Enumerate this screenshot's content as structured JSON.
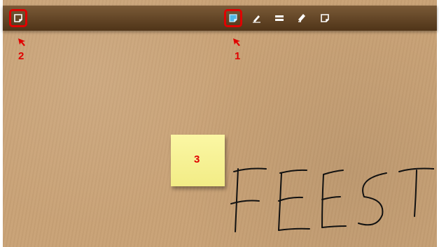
{
  "toolbar": {
    "tools": [
      {
        "name": "new-note-tool",
        "icon": "note-icon",
        "highlighted": true
      },
      {
        "name": "pen-tool",
        "icon": "pen-icon",
        "highlighted": false
      },
      {
        "name": "line-tool",
        "icon": "line-weight-icon",
        "highlighted": false
      },
      {
        "name": "eraser-tool",
        "icon": "eraser-icon",
        "highlighted": false
      },
      {
        "name": "sticky-tool",
        "icon": "sticky-note-icon",
        "highlighted": false
      }
    ],
    "left_button": {
      "icon": "note-icon",
      "highlighted": true
    }
  },
  "annotations": {
    "label_1": "1",
    "label_2": "2",
    "label_3": "3",
    "color": "#e00000"
  },
  "board": {
    "handwriting_text": "FEEST",
    "sticky_color": "#f6f19a"
  }
}
